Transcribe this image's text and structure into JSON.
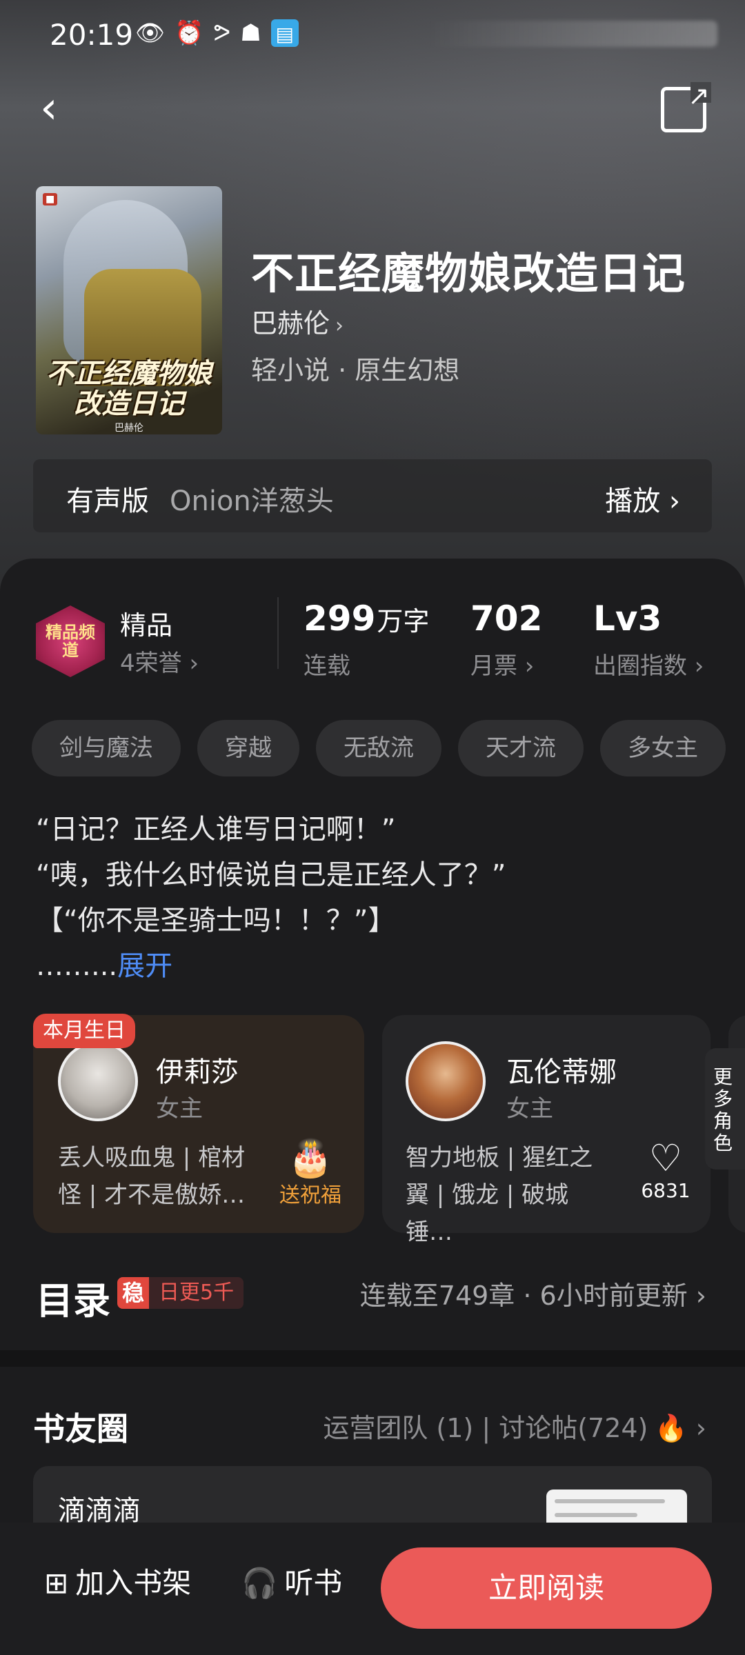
{
  "status_bar": {
    "time": "20:19",
    "icons": [
      "eye-icon",
      "alarm-icon",
      "nfc-icon",
      "qq-icon",
      "book-app-icon"
    ]
  },
  "header": {
    "back_icon": "chevron-left-icon",
    "share_icon": "share-icon"
  },
  "book": {
    "cover_title": "不正经魔物娘改造日记",
    "cover_author": "巴赫伦",
    "title": "不正经魔物娘改造日记",
    "author": "巴赫伦",
    "genre": "轻小说 · 原生幻想"
  },
  "audio": {
    "label": "有声版",
    "narrator": "Onion洋葱头",
    "play": "播放 ›"
  },
  "stats": {
    "honor_badge": "精品频道",
    "honor_title": "精品",
    "honor_sub": "4荣誉 ›",
    "words_num": "299",
    "words_unit": "万字",
    "words_label": "连载",
    "tickets_num": "702",
    "tickets_label": "月票 ›",
    "level_num": "Lv3",
    "level_label": "出圈指数 ›"
  },
  "tags": [
    "剑与魔法",
    "穿越",
    "无敌流",
    "天才流",
    "多女主"
  ],
  "synopsis": {
    "line1": "“日记？正经人谁写日记啊！”",
    "line2": "“咦，我什么时候说自己是正经人了？”",
    "line3": "【“你不是圣骑士吗！！？”】",
    "line4": "……...",
    "expand": "展开"
  },
  "characters": [
    {
      "badge": "本月生日",
      "name": "伊莉莎",
      "role": "女主",
      "desc": "丢人吸血鬼 | 棺材怪 | 才不是傲娇…",
      "action": "送祝福"
    },
    {
      "name": "瓦伦蒂娜",
      "role": "女主",
      "desc": "智力地板 | 猩红之翼 | 饿龙 | 破城锤…",
      "likes": "6831"
    }
  ],
  "more_roles": "更多角色",
  "toc": {
    "title": "目录",
    "badge_key": "稳",
    "badge_value": "日更5千",
    "status": "连载至749章 · 6小时前更新 ›"
  },
  "circle": {
    "title": "书友圈",
    "meta": "运营团队 (1) | 讨论帖(724)",
    "post_title": "滴滴滴"
  },
  "bottom": {
    "shelf": "加入书架",
    "listen": "听书",
    "read": "立即阅读"
  },
  "colors": {
    "accent": "#eb5a58",
    "link": "#4f8df7",
    "panel": "#1c1c1e"
  }
}
